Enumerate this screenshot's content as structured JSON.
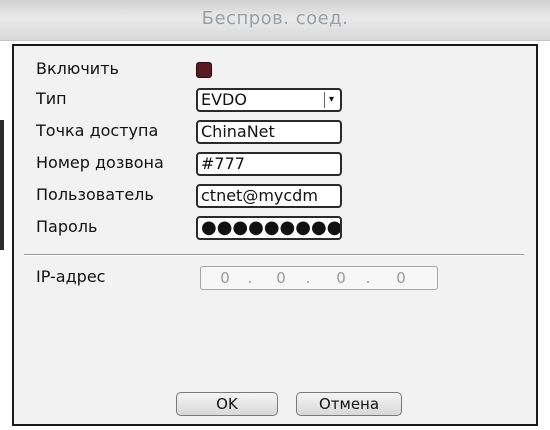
{
  "window": {
    "title": "Беспров. соед."
  },
  "form": {
    "enable_label": "Включить",
    "enable_checked": true,
    "type_label": "Тип",
    "type_value": "EVDO",
    "apn_label": "Точка доступа",
    "apn_value": "ChinaNet",
    "dial_label": "Номер дозвона",
    "dial_value": "#777",
    "user_label": "Пользователь",
    "user_value": "ctnet@mycdm",
    "password_label": "Пароль",
    "password_value": "●●●●●●●●●●",
    "ip_label": "IP-адрес",
    "ip_octets": [
      "0",
      "0",
      "0",
      "0"
    ],
    "ip_separator": "."
  },
  "buttons": {
    "ok": "OK",
    "cancel": "Отмена"
  },
  "colors": {
    "checkbox_fill": "#5a1a22",
    "title_text": "#9aa0a8",
    "panel_bg": "#f2f2f2"
  }
}
